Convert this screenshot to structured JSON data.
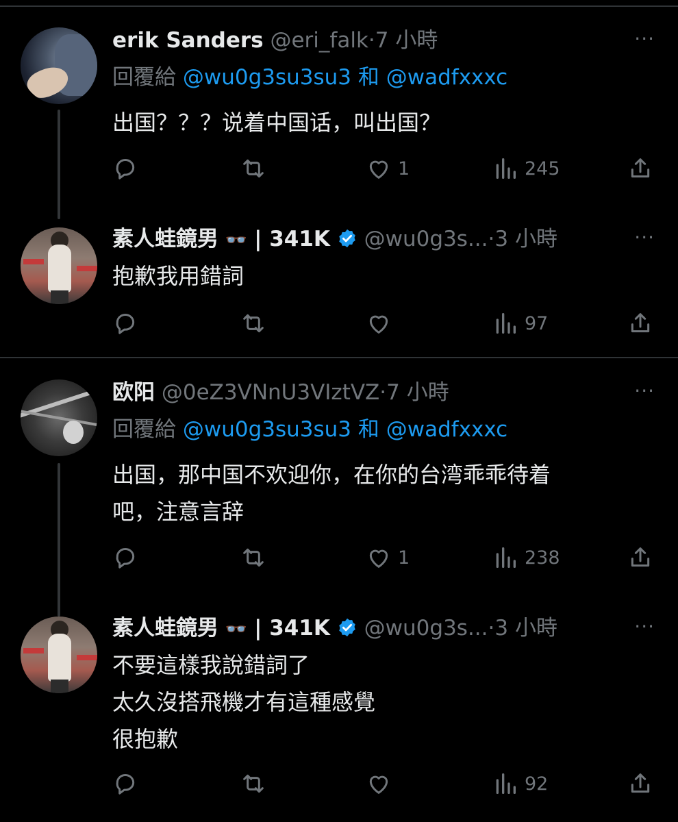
{
  "threads": [
    {
      "parent": {
        "name": "erik Sanders",
        "handle": "@eri_falk",
        "separator": "·",
        "time": "7 小時",
        "reply_prefix": "回覆給",
        "reply_mention_1": "@wu0g3su3su3",
        "reply_and": "和",
        "reply_mention_2": "@wadfxxxc",
        "text_lines": [
          "出国？？？说着中国话，叫出国？"
        ],
        "replies": "",
        "retweets": "",
        "likes": "1",
        "views": "245"
      },
      "reply": {
        "name": "素人蛙鏡男",
        "emoji": "👓",
        "name_suffix": "| 341K",
        "handle": "@wu0g3s...",
        "separator": "·",
        "time": "3 小時",
        "text_lines": [
          "抱歉我用錯詞"
        ],
        "likes": "",
        "views": "97"
      }
    },
    {
      "parent": {
        "name": "欧阳",
        "handle": "@0eZ3VNnU3VIztVZ",
        "separator": "·",
        "time": "7 小時",
        "reply_prefix": "回覆給",
        "reply_mention_1": "@wu0g3su3su3",
        "reply_and": "和",
        "reply_mention_2": "@wadfxxxc",
        "text_lines": [
          "出国，那中国不欢迎你，在你的台湾乖乖待着",
          "吧，注意言辞"
        ],
        "likes": "1",
        "views": "238"
      },
      "reply": {
        "name": "素人蛙鏡男",
        "emoji": "👓",
        "name_suffix": "| 341K",
        "handle": "@wu0g3s...",
        "separator": "·",
        "time": "3 小時",
        "text_lines": [
          "不要這樣我說錯詞了",
          "太久沒搭飛機才有這種感覺",
          "很抱歉"
        ],
        "likes": "",
        "views": "92"
      }
    }
  ],
  "more_glyph": "···",
  "icons": {
    "reply": "reply-icon",
    "retweet": "retweet-icon",
    "like": "heart-icon",
    "views": "views-icon",
    "share": "share-icon",
    "verified": "verified-badge-icon"
  },
  "colors": {
    "background": "#000000",
    "text": "#e7e9ea",
    "secondary": "#71767b",
    "link": "#1d9bf0",
    "divider": "#2f3336"
  }
}
